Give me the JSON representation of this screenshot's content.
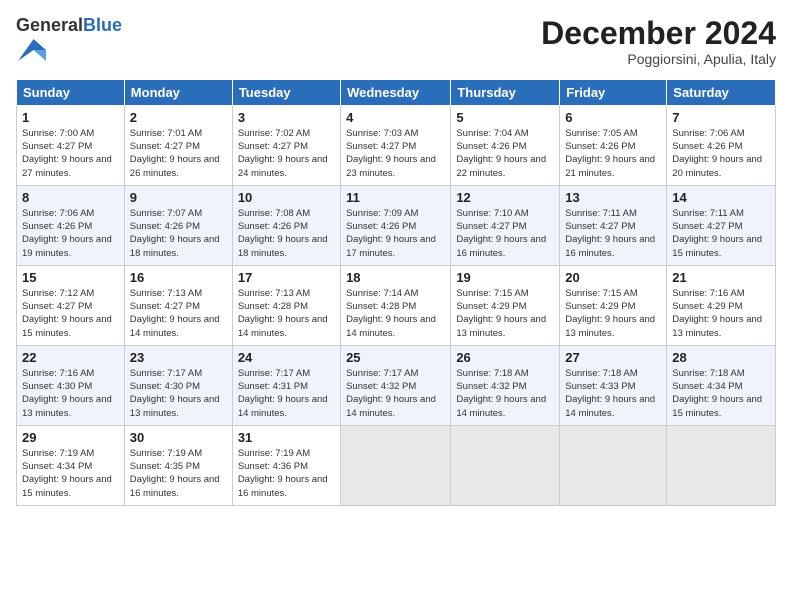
{
  "header": {
    "logo_general": "General",
    "logo_blue": "Blue",
    "month_title": "December 2024",
    "subtitle": "Poggiorsini, Apulia, Italy"
  },
  "weekdays": [
    "Sunday",
    "Monday",
    "Tuesday",
    "Wednesday",
    "Thursday",
    "Friday",
    "Saturday"
  ],
  "weeks": [
    [
      {
        "day": "1",
        "sunrise": "7:00 AM",
        "sunset": "4:27 PM",
        "daylight": "9 hours and 27 minutes."
      },
      {
        "day": "2",
        "sunrise": "7:01 AM",
        "sunset": "4:27 PM",
        "daylight": "9 hours and 26 minutes."
      },
      {
        "day": "3",
        "sunrise": "7:02 AM",
        "sunset": "4:27 PM",
        "daylight": "9 hours and 24 minutes."
      },
      {
        "day": "4",
        "sunrise": "7:03 AM",
        "sunset": "4:27 PM",
        "daylight": "9 hours and 23 minutes."
      },
      {
        "day": "5",
        "sunrise": "7:04 AM",
        "sunset": "4:26 PM",
        "daylight": "9 hours and 22 minutes."
      },
      {
        "day": "6",
        "sunrise": "7:05 AM",
        "sunset": "4:26 PM",
        "daylight": "9 hours and 21 minutes."
      },
      {
        "day": "7",
        "sunrise": "7:06 AM",
        "sunset": "4:26 PM",
        "daylight": "9 hours and 20 minutes."
      }
    ],
    [
      {
        "day": "8",
        "sunrise": "7:06 AM",
        "sunset": "4:26 PM",
        "daylight": "9 hours and 19 minutes."
      },
      {
        "day": "9",
        "sunrise": "7:07 AM",
        "sunset": "4:26 PM",
        "daylight": "9 hours and 18 minutes."
      },
      {
        "day": "10",
        "sunrise": "7:08 AM",
        "sunset": "4:26 PM",
        "daylight": "9 hours and 18 minutes."
      },
      {
        "day": "11",
        "sunrise": "7:09 AM",
        "sunset": "4:26 PM",
        "daylight": "9 hours and 17 minutes."
      },
      {
        "day": "12",
        "sunrise": "7:10 AM",
        "sunset": "4:27 PM",
        "daylight": "9 hours and 16 minutes."
      },
      {
        "day": "13",
        "sunrise": "7:11 AM",
        "sunset": "4:27 PM",
        "daylight": "9 hours and 16 minutes."
      },
      {
        "day": "14",
        "sunrise": "7:11 AM",
        "sunset": "4:27 PM",
        "daylight": "9 hours and 15 minutes."
      }
    ],
    [
      {
        "day": "15",
        "sunrise": "7:12 AM",
        "sunset": "4:27 PM",
        "daylight": "9 hours and 15 minutes."
      },
      {
        "day": "16",
        "sunrise": "7:13 AM",
        "sunset": "4:27 PM",
        "daylight": "9 hours and 14 minutes."
      },
      {
        "day": "17",
        "sunrise": "7:13 AM",
        "sunset": "4:28 PM",
        "daylight": "9 hours and 14 minutes."
      },
      {
        "day": "18",
        "sunrise": "7:14 AM",
        "sunset": "4:28 PM",
        "daylight": "9 hours and 14 minutes."
      },
      {
        "day": "19",
        "sunrise": "7:15 AM",
        "sunset": "4:29 PM",
        "daylight": "9 hours and 13 minutes."
      },
      {
        "day": "20",
        "sunrise": "7:15 AM",
        "sunset": "4:29 PM",
        "daylight": "9 hours and 13 minutes."
      },
      {
        "day": "21",
        "sunrise": "7:16 AM",
        "sunset": "4:29 PM",
        "daylight": "9 hours and 13 minutes."
      }
    ],
    [
      {
        "day": "22",
        "sunrise": "7:16 AM",
        "sunset": "4:30 PM",
        "daylight": "9 hours and 13 minutes."
      },
      {
        "day": "23",
        "sunrise": "7:17 AM",
        "sunset": "4:30 PM",
        "daylight": "9 hours and 13 minutes."
      },
      {
        "day": "24",
        "sunrise": "7:17 AM",
        "sunset": "4:31 PM",
        "daylight": "9 hours and 14 minutes."
      },
      {
        "day": "25",
        "sunrise": "7:17 AM",
        "sunset": "4:32 PM",
        "daylight": "9 hours and 14 minutes."
      },
      {
        "day": "26",
        "sunrise": "7:18 AM",
        "sunset": "4:32 PM",
        "daylight": "9 hours and 14 minutes."
      },
      {
        "day": "27",
        "sunrise": "7:18 AM",
        "sunset": "4:33 PM",
        "daylight": "9 hours and 14 minutes."
      },
      {
        "day": "28",
        "sunrise": "7:18 AM",
        "sunset": "4:34 PM",
        "daylight": "9 hours and 15 minutes."
      }
    ],
    [
      {
        "day": "29",
        "sunrise": "7:19 AM",
        "sunset": "4:34 PM",
        "daylight": "9 hours and 15 minutes."
      },
      {
        "day": "30",
        "sunrise": "7:19 AM",
        "sunset": "4:35 PM",
        "daylight": "9 hours and 16 minutes."
      },
      {
        "day": "31",
        "sunrise": "7:19 AM",
        "sunset": "4:36 PM",
        "daylight": "9 hours and 16 minutes."
      },
      null,
      null,
      null,
      null
    ]
  ],
  "labels": {
    "sunrise": "Sunrise:",
    "sunset": "Sunset:",
    "daylight": "Daylight:"
  }
}
